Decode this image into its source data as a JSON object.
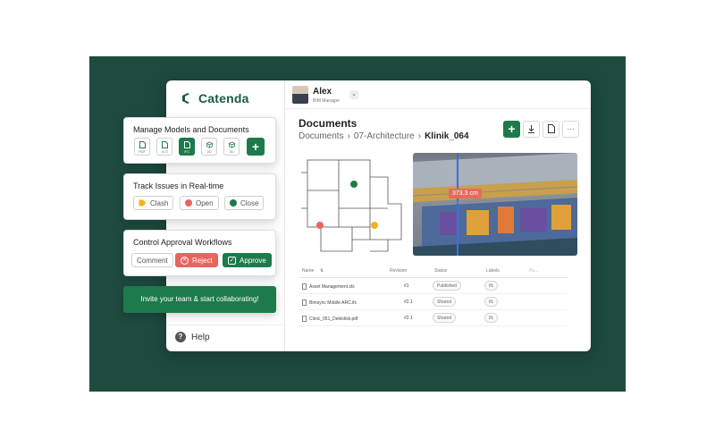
{
  "app": {
    "name": "Catenda"
  },
  "user": {
    "name": "Alex",
    "role": "BIM Manager"
  },
  "documents": {
    "title": "Documents",
    "breadcrumb": [
      "Documents",
      "07-Architecture",
      "Klinik_064"
    ]
  },
  "toolbar": {
    "add_label": "+",
    "more_label": "···"
  },
  "viewer": {
    "measurement": "373.3 cm"
  },
  "table": {
    "headers": {
      "name": "Name",
      "revision": "Revision",
      "status": "Status",
      "labels": "Labels",
      "extra": "Pu..."
    },
    "rows": [
      {
        "name": "Asset Management.xls",
        "revision": "#1",
        "status": "Published",
        "labels": "Ifc"
      },
      {
        "name": "Bimsync Mobile ARC.ifc",
        "revision": "#2.1",
        "status": "Shared",
        "labels": "Ifc"
      },
      {
        "name": "Clinic_051_Deklolisk.pdf",
        "revision": "#2.1",
        "status": "Shared",
        "labels": "Ifc"
      }
    ]
  },
  "help": {
    "label": "Help"
  },
  "cards": {
    "models": {
      "title": "Manage Models and Documents",
      "formats": [
        "PDF",
        "XLS",
        "IFC",
        "2D",
        "3D"
      ]
    },
    "issues": {
      "title": "Track Issues in Real-time",
      "chips": [
        "Clash",
        "Open",
        "Close"
      ]
    },
    "approval": {
      "title": "Control Approval Workflows",
      "comment": "Comment",
      "reject": "Reject",
      "approve": "Approve"
    },
    "cta": "Invite your team & start collaborating!"
  },
  "colors": {
    "background": "#1e4a3f",
    "brand_green": "#1d7a4a",
    "reject_red": "#e8645d",
    "clash_yellow": "#f2b21c"
  }
}
